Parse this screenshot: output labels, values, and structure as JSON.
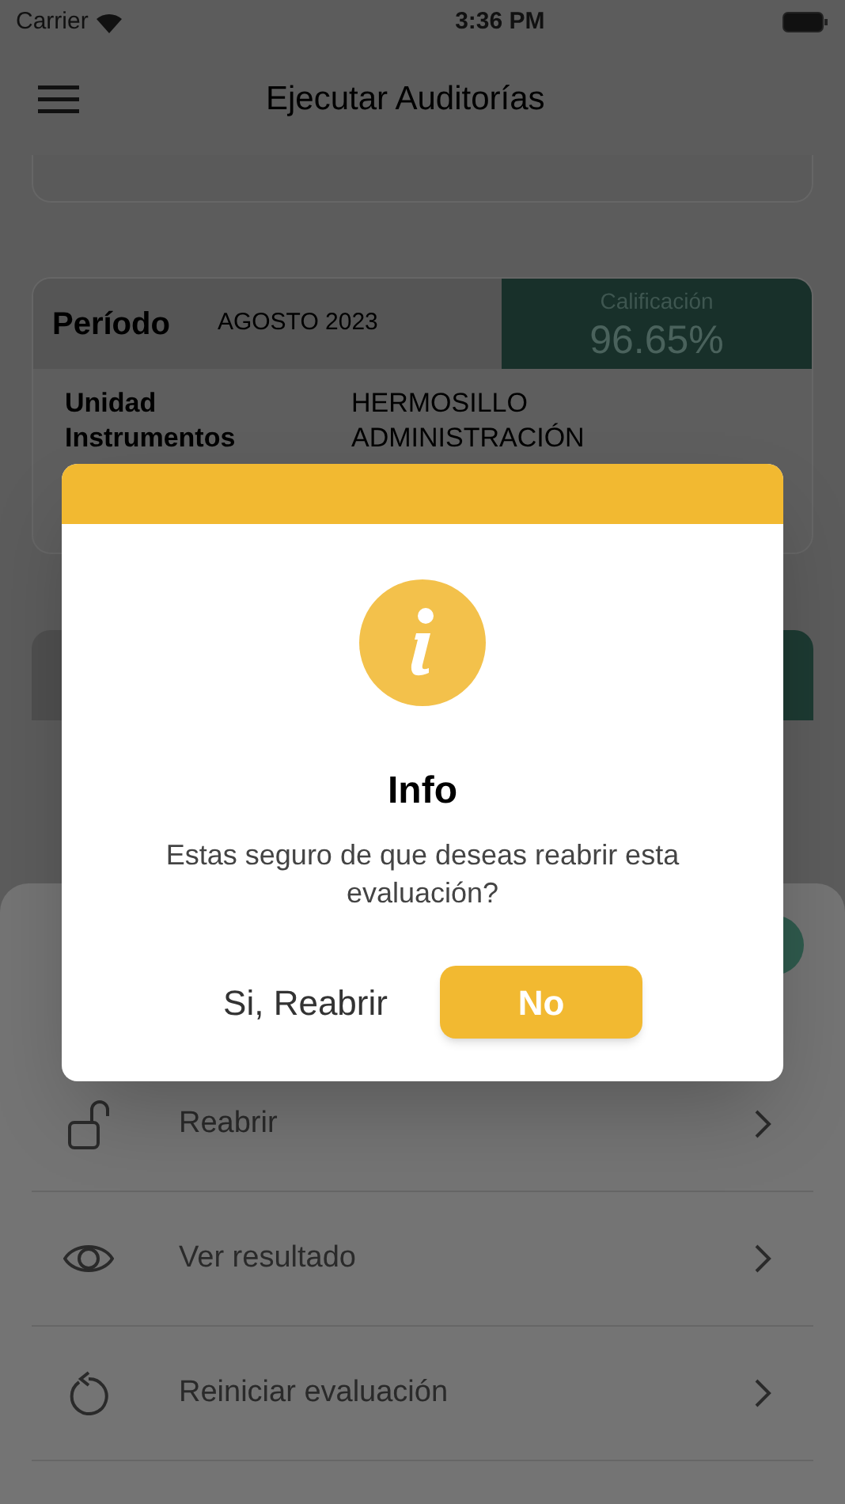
{
  "status_bar": {
    "carrier": "Carrier",
    "time": "3:36 PM"
  },
  "header": {
    "title": "Ejecutar Auditorías"
  },
  "period_card": {
    "label": "Período",
    "value": "AGOSTO 2023",
    "score_label": "Calificación",
    "score": "96.65%",
    "rows": [
      {
        "label": "Unidad",
        "value": "HERMOSILLO"
      },
      {
        "label": "Instrumentos",
        "value": "ADMINISTRACIÓN"
      }
    ]
  },
  "action_sheet": {
    "items": [
      {
        "kind": "unlock",
        "label": "Reabrir"
      },
      {
        "kind": "eye",
        "label": "Ver resultado"
      },
      {
        "kind": "restart",
        "label": "Reiniciar evaluación"
      }
    ]
  },
  "dialog": {
    "title": "Info",
    "message": "Estas seguro de que deseas reabrir esta evaluación?",
    "buttons": [
      {
        "kind": "text",
        "label": "Si, Reabrir"
      },
      {
        "kind": "primary",
        "label": "No"
      }
    ]
  }
}
